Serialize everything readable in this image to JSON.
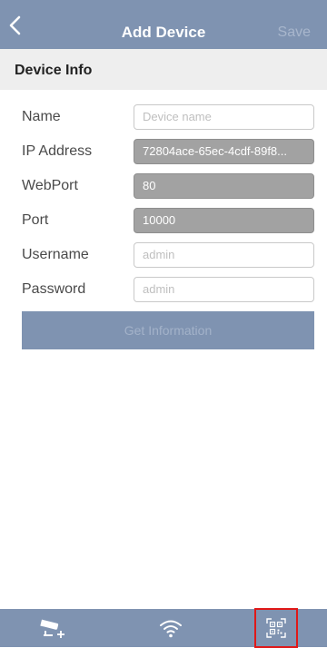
{
  "header": {
    "title": "Add Device",
    "save_label": "Save"
  },
  "section": {
    "title": "Device Info"
  },
  "form": {
    "name": {
      "label": "Name",
      "placeholder": "Device name",
      "value": ""
    },
    "ip_address": {
      "label": "IP Address",
      "value": "72804ace-65ec-4cdf-89f8..."
    },
    "web_port": {
      "label": "WebPort",
      "value": "80"
    },
    "port": {
      "label": "Port",
      "value": "10000"
    },
    "username": {
      "label": "Username",
      "placeholder": "admin",
      "value": ""
    },
    "password": {
      "label": "Password",
      "placeholder": "admin",
      "value": ""
    }
  },
  "actions": {
    "get_information_label": "Get Information"
  },
  "tabbar": {
    "tabs": [
      {
        "icon": "camera-add-icon"
      },
      {
        "icon": "wifi-icon"
      },
      {
        "icon": "qr-scan-icon",
        "highlighted": true
      }
    ]
  },
  "colors": {
    "nav_bg": "#7f93b1",
    "section_bg": "#eeeeee",
    "disabled_field_bg": "#a2a2a2",
    "highlight": "#e01818"
  }
}
